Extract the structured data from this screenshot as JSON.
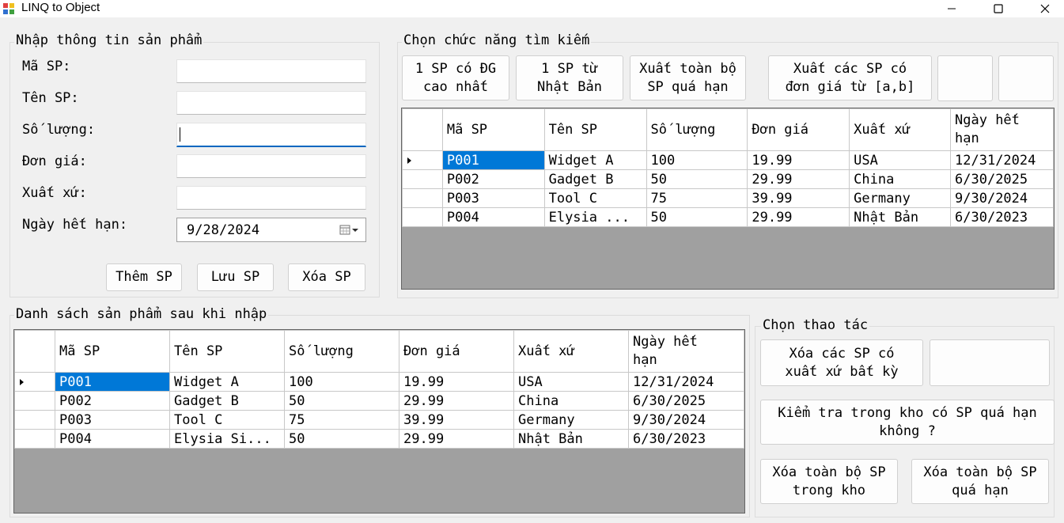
{
  "window": {
    "title": "LINQ to Object"
  },
  "input_group": {
    "title": "Nhập thông tin sản phẩm",
    "fields": [
      {
        "label": "Mã SP:",
        "value": ""
      },
      {
        "label": "Tên SP:",
        "value": ""
      },
      {
        "label": "Số lượng:",
        "value": ""
      },
      {
        "label": "Đơn giá:",
        "value": ""
      },
      {
        "label": "Xuất xứ:",
        "value": ""
      }
    ],
    "date_label": "Ngày hết hạn:",
    "date_value": "9/28/2024",
    "buttons": {
      "add": "Thêm SP",
      "save": "Lưu SP",
      "delete": "Xóa SP"
    }
  },
  "search_group": {
    "title": "Chọn chức năng tìm kiếm",
    "buttons": [
      "1 SP có ĐG\ncao nhất",
      "1 SP từ\nNhật Bản",
      "Xuất toàn bộ\nSP quá hạn",
      "Xuất các SP có\nđơn giá từ [a,b]",
      "",
      ""
    ]
  },
  "grid_columns": [
    "Mã SP",
    "Tên SP",
    "Số lượng",
    "Đơn giá",
    "Xuất xứ",
    "Ngày hết\nhạn"
  ],
  "search_grid_rows": [
    [
      "P001",
      "Widget A",
      "100",
      "19.99",
      "USA",
      "12/31/2024"
    ],
    [
      "P002",
      "Gadget B",
      "50",
      "29.99",
      "China",
      "6/30/2025"
    ],
    [
      "P003",
      "Tool C",
      "75",
      "39.99",
      "Germany",
      "9/30/2024"
    ],
    [
      "P004",
      "Elysia ...",
      "50",
      "29.99",
      "Nhật Bản",
      "6/30/2023"
    ]
  ],
  "list_group": {
    "title": "Danh sách sản phẩm sau khi nhập"
  },
  "list_grid_rows": [
    [
      "P001",
      "Widget A",
      "100",
      "19.99",
      "USA",
      "12/31/2024"
    ],
    [
      "P002",
      "Gadget B",
      "50",
      "29.99",
      "China",
      "6/30/2025"
    ],
    [
      "P003",
      "Tool C",
      "75",
      "39.99",
      "Germany",
      "9/30/2024"
    ],
    [
      "P004",
      "Elysia Si...",
      "50",
      "29.99",
      "Nhật Bản",
      "6/30/2023"
    ]
  ],
  "action_group": {
    "title": "Chọn thao tác",
    "delete_by_origin": "Xóa các SP có\nxuất xứ bất kỳ",
    "blank": "",
    "check_expired": "Kiểm tra trong kho có SP quá hạn\nkhông ?",
    "delete_all_stock": "Xóa toàn bộ SP\ntrong kho",
    "delete_all_expired": "Xóa toàn bộ SP\nquá hạn"
  }
}
